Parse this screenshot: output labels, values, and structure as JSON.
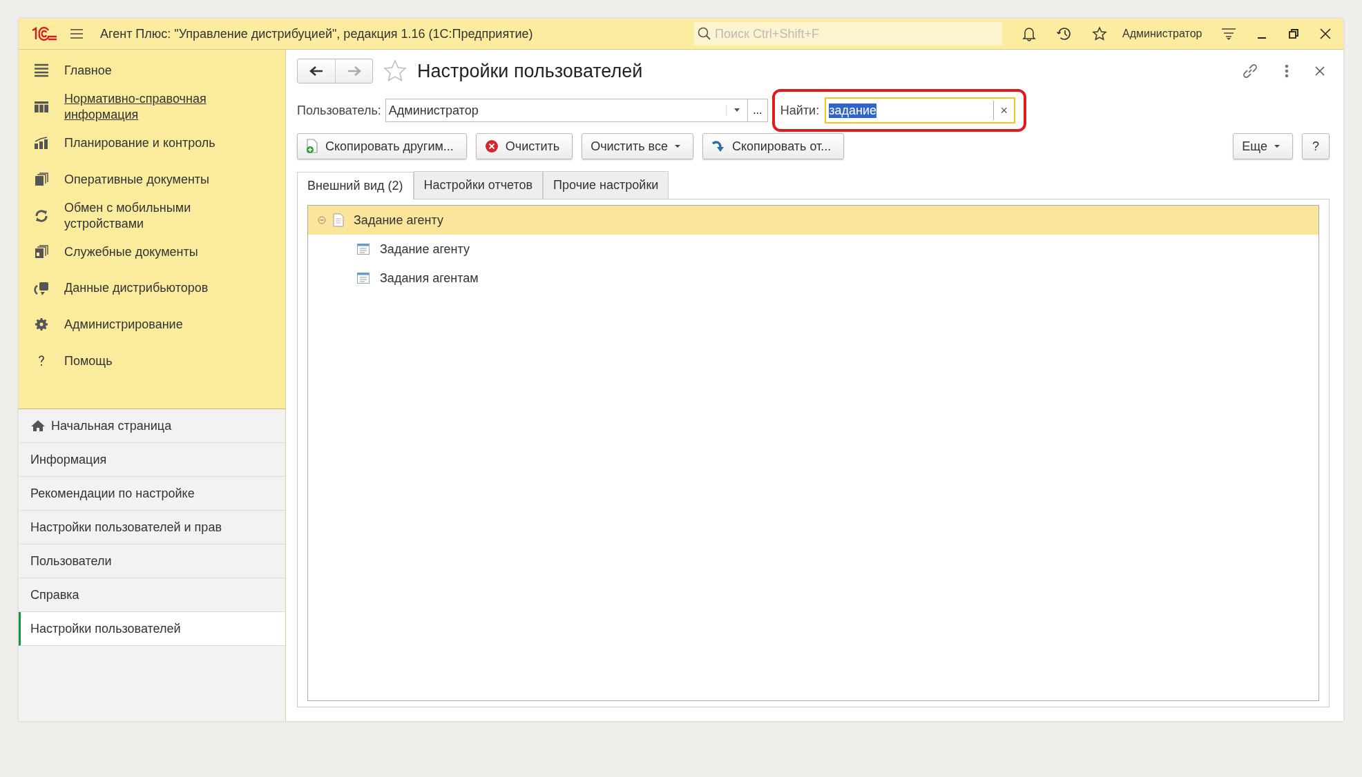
{
  "title_bar": {
    "title": "Агент Плюс: \"Управление дистрибуцией\", редакция 1.16  (1С:Предприятие)",
    "search": {
      "placeholder": "Поиск Ctrl+Shift+F"
    },
    "user": "Администратор"
  },
  "sections": [
    {
      "label": "Главное",
      "hovered": false
    },
    {
      "label": "Нормативно-справочная информация",
      "hovered": true
    },
    {
      "label": "Планирование и контроль",
      "hovered": false
    },
    {
      "label": "Оперативные документы",
      "hovered": false
    },
    {
      "label": "Обмен с мобильными устройствами",
      "hovered": false
    },
    {
      "label": "Служебные документы",
      "hovered": false
    },
    {
      "label": "Данные дистрибьюторов",
      "hovered": false
    },
    {
      "label": "Администрирование",
      "hovered": false
    },
    {
      "label": "Помощь",
      "hovered": false
    }
  ],
  "open_pages": [
    {
      "label": "Начальная страница",
      "kind": "home",
      "selected": false
    },
    {
      "label": "Информация",
      "kind": "page",
      "selected": false
    },
    {
      "label": "Рекомендации по настройке",
      "kind": "page",
      "selected": false
    },
    {
      "label": "Настройки пользователей и прав",
      "kind": "page",
      "selected": false
    },
    {
      "label": "Пользователи",
      "kind": "page",
      "selected": false
    },
    {
      "label": "Справка",
      "kind": "page",
      "selected": false
    },
    {
      "label": "Настройки пользователей",
      "kind": "page",
      "selected": true
    }
  ],
  "form": {
    "title": "Настройки пользователей",
    "user_field": {
      "label": "Пользователь:",
      "value": "Администратор",
      "more": "..."
    },
    "find_field": {
      "label": "Найти:",
      "value": "задание",
      "clear": "×",
      "highlighted": true
    },
    "buttons": [
      {
        "label": "Скопировать другим...",
        "kind": "copy-doc"
      },
      {
        "label": "Очистить",
        "kind": "clear"
      },
      {
        "label": "Очистить все",
        "kind": "dropdown"
      },
      {
        "label": "Скопировать от...",
        "kind": "copy-arrow"
      }
    ],
    "more_button": "Еще",
    "help_button": "?",
    "tabs": [
      {
        "label": "Внешний вид (2)",
        "selected": true
      },
      {
        "label": "Настройки отчетов",
        "selected": false
      },
      {
        "label": "Прочие настройки",
        "selected": false
      }
    ],
    "tree": [
      {
        "label": "Задание агенту",
        "expanded": true,
        "selected": true,
        "children": [
          {
            "label": "Задание агенту",
            "selected": false
          },
          {
            "label": "Задания агентам",
            "selected": false
          }
        ]
      }
    ]
  }
}
